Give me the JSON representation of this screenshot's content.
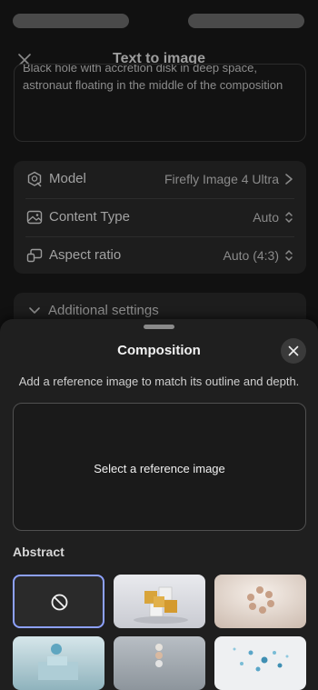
{
  "status_bar": {},
  "header": {
    "title": "Text to image",
    "close_icon": "close-icon"
  },
  "prompt": {
    "text": "Black hole with accretion disk in deep space, astronaut floating in the middle of the composition"
  },
  "settings": {
    "model": {
      "icon": "model-icon",
      "label": "Model",
      "value": "Firefly Image 4 Ultra",
      "chevron": "chevron-right-icon"
    },
    "content_type": {
      "icon": "image-icon",
      "label": "Content Type",
      "value": "Auto",
      "chevron": "up-down-chevron-icon"
    },
    "aspect_ratio": {
      "icon": "aspect-ratio-icon",
      "label": "Aspect ratio",
      "value": "Auto (4:3)",
      "chevron": "up-down-chevron-icon"
    }
  },
  "additional_settings": {
    "label": "Additional settings",
    "icon": "chevron-down-icon"
  },
  "sheet": {
    "title": "Composition",
    "description": "Add a reference image to match its outline and depth.",
    "reference_button": "Select a reference image",
    "section_label": "Abstract",
    "thumbnails": [
      {
        "name": "none",
        "selected": true
      },
      {
        "name": "gold-cubes"
      },
      {
        "name": "beige-spheres-ring"
      },
      {
        "name": "sphere-on-blocks"
      },
      {
        "name": "stacked-spheres"
      },
      {
        "name": "floating-molecules"
      }
    ]
  },
  "colors": {
    "background": "#111111",
    "sheet": "#1f1f1f",
    "selection_accent": "#8da1ff"
  }
}
